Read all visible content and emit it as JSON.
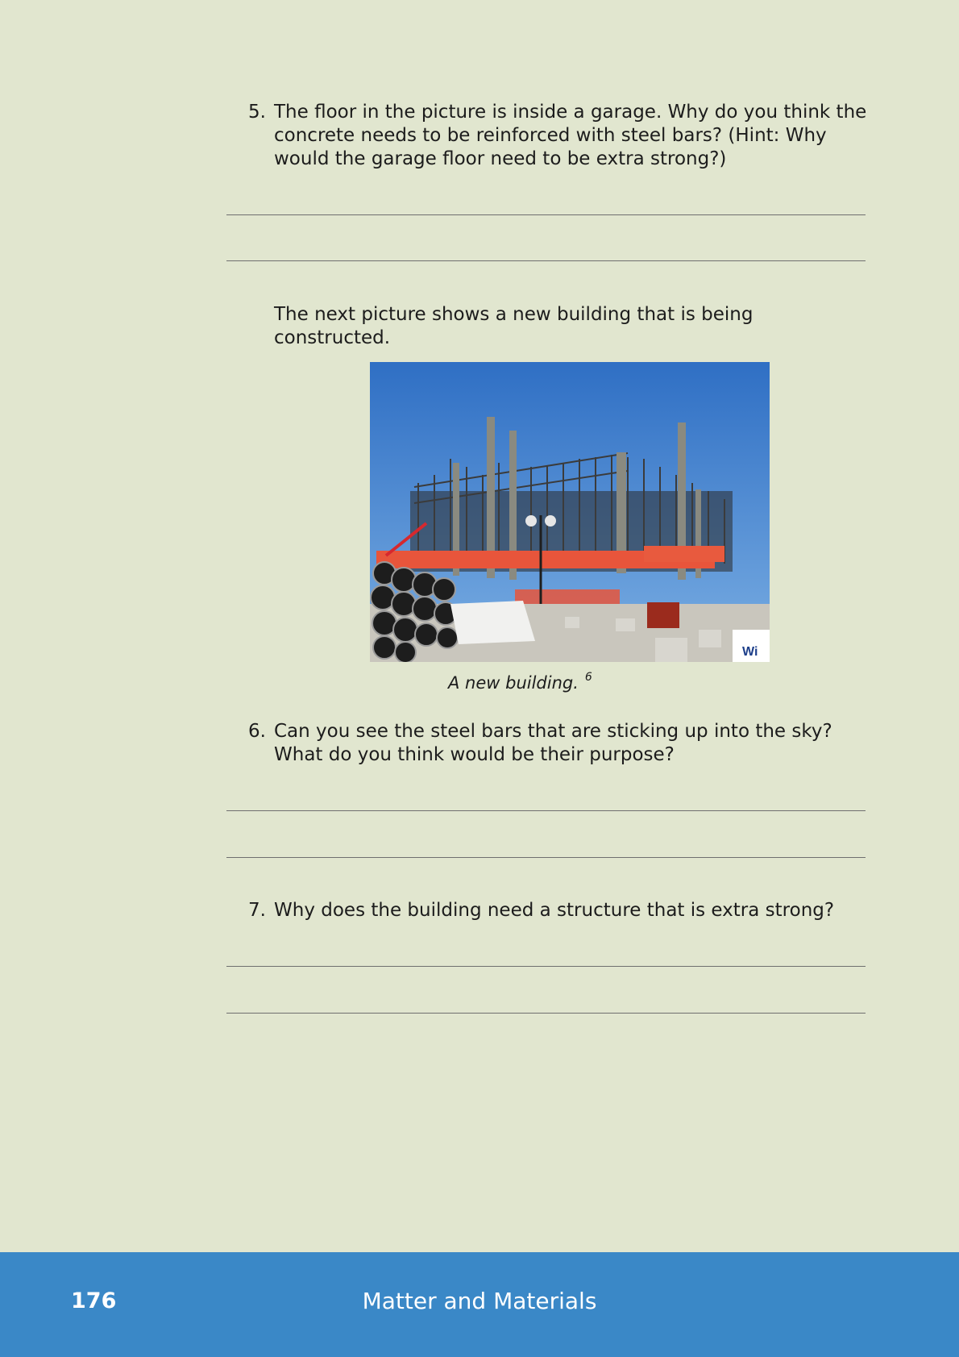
{
  "questions": [
    {
      "number": "5.",
      "text": "The floor in the picture is inside a garage. Why do you think the concrete needs to be reinforced with steel bars? (Hint: Why would the garage floor need to be extra strong?)"
    },
    {
      "number": "6.",
      "text": "Can you see the steel bars that are sticking up into the sky? What do you think would be their purpose?"
    },
    {
      "number": "7.",
      "text": "Why does the building need a structure that is extra strong?"
    }
  ],
  "intro": "The next picture shows a new building that is being constructed.",
  "figure": {
    "caption": "A new building.",
    "footnote": "6",
    "sign_text": "Wi"
  },
  "footer": {
    "page_number": "176",
    "title": "Matter and Materials"
  },
  "colors": {
    "page_background": "#e1e6cf",
    "footer_background": "#3a88c7"
  }
}
